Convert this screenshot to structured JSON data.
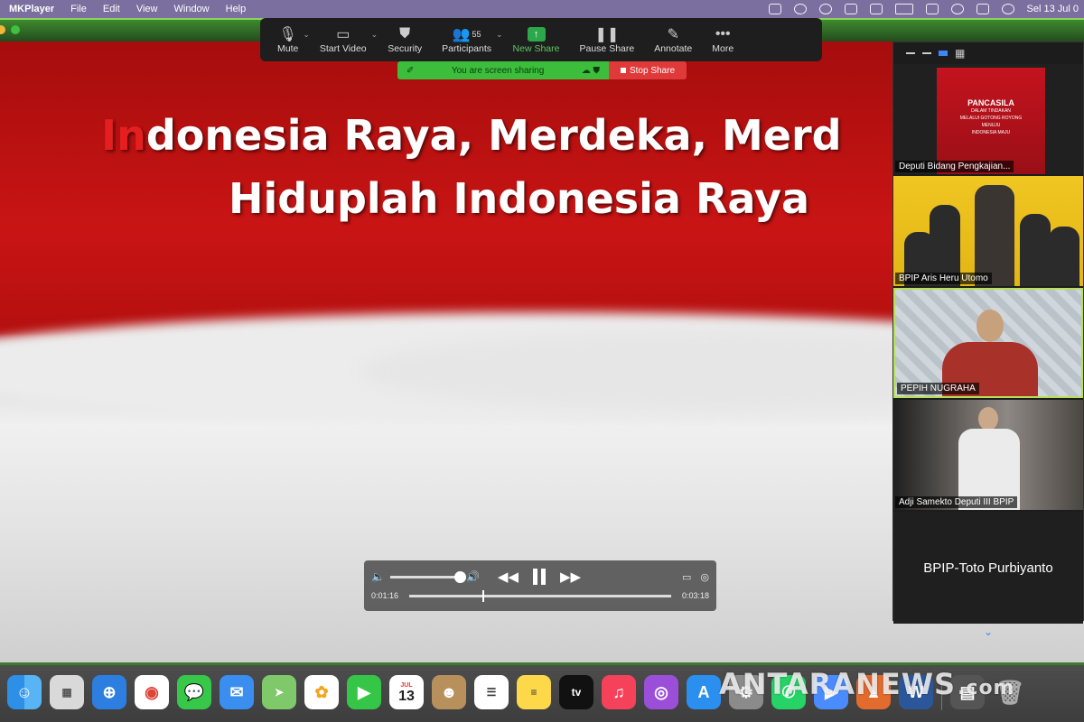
{
  "menubar": {
    "app": "MKPlayer",
    "items": [
      "File",
      "Edit",
      "View",
      "Window",
      "Help"
    ],
    "clock": "Sel 13 Jul 0"
  },
  "lyrics": {
    "line1_hl": "In",
    "line1_rest": "donesia Raya, Merdeka, Merd",
    "line2": "Hiduplah Indonesia Raya"
  },
  "zoom_toolbar": {
    "mute": "Mute",
    "start_video": "Start Video",
    "security": "Security",
    "participants": "Participants",
    "participant_count": "55",
    "new_share": "New Share",
    "pause_share": "Pause Share",
    "annotate": "Annotate",
    "more": "More"
  },
  "share_banner": {
    "status": "You are screen sharing",
    "stop": "Stop Share"
  },
  "gallery": {
    "tiles": [
      {
        "name": "Deputi Bidang Pengkajian...",
        "poster_title": "PANCASILA",
        "poster_line2": "DALAM TINDAKAN",
        "poster_line3": "MELALUI GOTONG ROYONG",
        "poster_line4": "MENUJU",
        "poster_line5": "INDONESIA MAJU"
      },
      {
        "name": "BPIP Aris Heru Utomo"
      },
      {
        "name": "PEPIH NUGRAHA"
      },
      {
        "name": "Adji Samekto Deputi III BPIP"
      },
      {
        "name": "BPIP-Toto Purbiyanto"
      }
    ]
  },
  "player": {
    "elapsed": "0:01:16",
    "duration": "0:03:18",
    "volume_fraction": 1.0,
    "progress_fraction": 0.28
  },
  "dock": {
    "calendar_month": "JUL",
    "calendar_day": "13",
    "icons": [
      "finder-icon",
      "launchpad-icon",
      "safari-icon",
      "chrome-icon",
      "messages-icon",
      "mail-icon",
      "maps-icon",
      "photos-icon",
      "facetime-icon",
      "calendar-icon",
      "contacts-icon",
      "reminders-icon",
      "notes-icon",
      "appletv-icon",
      "music-icon",
      "podcasts-icon",
      "appstore-icon"
    ],
    "appletv_label": "tv"
  },
  "watermark": {
    "brand": "ANTARANEWS",
    "domain": ".com"
  },
  "colors": {
    "zoom_green": "#3cbd3c",
    "stop_red": "#e0393a",
    "flag_red": "#c91414",
    "active_tile_border": "#b8e05a"
  }
}
